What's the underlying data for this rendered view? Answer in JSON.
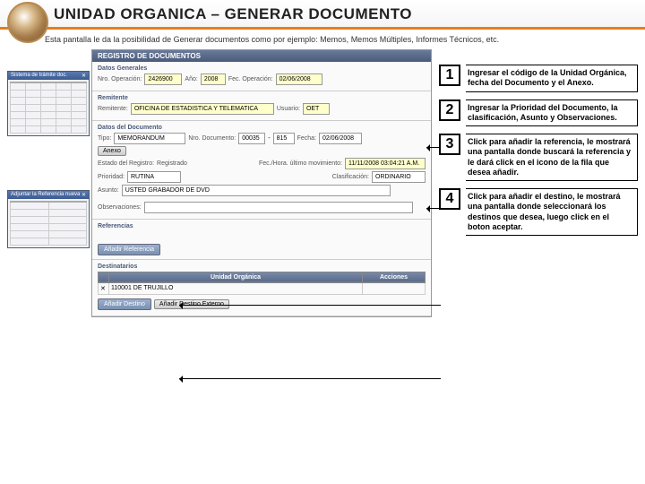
{
  "header": {
    "title": "UNIDAD ORGANICA – GENERAR DOCUMENTO",
    "subtitle": "Esta pantalla le da la posibilidad de Generar documentos como por ejemplo: Memos, Memos Múltiples, Informes Técnicos, etc."
  },
  "form": {
    "window_title": "REGISTRO DE DOCUMENTOS",
    "sections": {
      "datos_generales": "Datos Generales",
      "remitente": "Remitente",
      "datos_documento": "Datos del Documento",
      "referencias": "Referencias",
      "destinatarios": "Destinatarios"
    },
    "labels": {
      "nro_operacion": "Nro. Operación:",
      "ano": "Año:",
      "fec_operacion": "Fec. Operación:",
      "remitente": "Remitente:",
      "usuario": "Usuario:",
      "tipo": "Tipo:",
      "nro_documento": "Nro. Documento:",
      "fecha": "Fecha:",
      "estado_registro": "Estado del Registro:",
      "fec_ultimo_mov": "Fec./Hora. último movimiento:",
      "prioridad": "Prioridad:",
      "clasificacion": "Clasificación:",
      "asunto": "Asunto:",
      "observaciones": "Observaciones:",
      "unidad_organica": "Unidad Orgánica",
      "acciones": "Acciones"
    },
    "values": {
      "nro_operacion": "2426900",
      "ano": "2008",
      "fec_operacion": "02/06/2008",
      "remitente": "OFICINA DE ESTADISTICA Y TELEMATICA",
      "usuario": "OET",
      "tipo": "MEMORANDUM",
      "nro_doc_1": "00035",
      "nro_doc_2": "815",
      "fecha": "02/06/2008",
      "estado": "Registrado",
      "fec_mov": "11/11/2008 03:04:21 A.M.",
      "prioridad": "RUTINA",
      "clasificacion": "ORDINARIO",
      "asunto": "USTED GRABADOR DE DVD",
      "dest_row": "110001 DE TRUJILLO"
    },
    "buttons": {
      "anadir_referencia": "Añadir Referencia",
      "anadir_destino": "Añadir Destino",
      "anadir_destino_externo": "Añadir Destino Externo",
      "anexo": "Anexo"
    }
  },
  "side": {
    "win1_title": "Sistema de trámite doc.",
    "win2_title": "Adjuntar la Referencia nueva"
  },
  "callouts": [
    {
      "num": "1",
      "text": "Ingresar el código de la Unidad Orgánica, fecha del Documento y el Anexo."
    },
    {
      "num": "2",
      "text": "Ingresar la Prioridad del Documento, la clasificación, Asunto y Observaciones."
    },
    {
      "num": "3",
      "text": "Click para añadir la referencia, le mostrará una pantalla donde buscará la referencia y le dará click en el icono de la fila que desea añadir."
    },
    {
      "num": "4",
      "text": "Click para añadir el destino, le mostrará una pantalla donde seleccionará los destinos que desea, luego click en el boton aceptar."
    }
  ]
}
